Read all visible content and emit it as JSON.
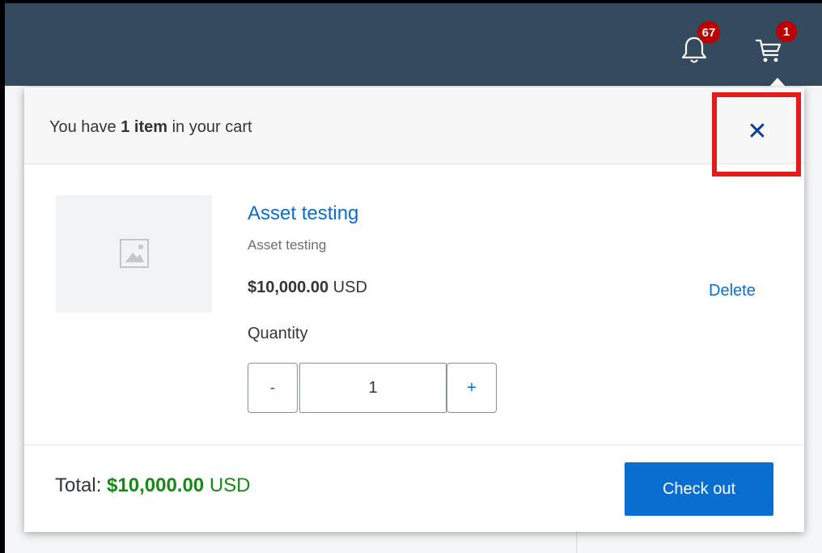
{
  "colors": {
    "topbar": "#354a5f",
    "accent": "#0a6ed1",
    "badge": "#bb0000",
    "total": "#188918",
    "highlight": "#e31b1b"
  },
  "shell": {
    "notifications": {
      "icon": "bell-icon",
      "count": "67"
    },
    "cart": {
      "icon": "cart-icon",
      "count": "1"
    }
  },
  "cart_popover": {
    "header": {
      "prefix": "You have ",
      "count_text": "1 item",
      "suffix": " in your cart",
      "close_icon": "close-icon",
      "close_glyph": "✕"
    },
    "items": [
      {
        "image_icon": "image-placeholder-icon",
        "title": "Asset testing",
        "subtitle": "Asset testing",
        "price": "$10,000.00",
        "currency": "USD",
        "delete_label": "Delete",
        "quantity_label": "Quantity",
        "quantity": "1",
        "decrement_label": "-",
        "increment_label": "+"
      }
    ],
    "footer": {
      "total_label": "Total: ",
      "total_amount": "$10,000.00",
      "total_currency": "USD",
      "checkout_label": "Check out"
    }
  }
}
